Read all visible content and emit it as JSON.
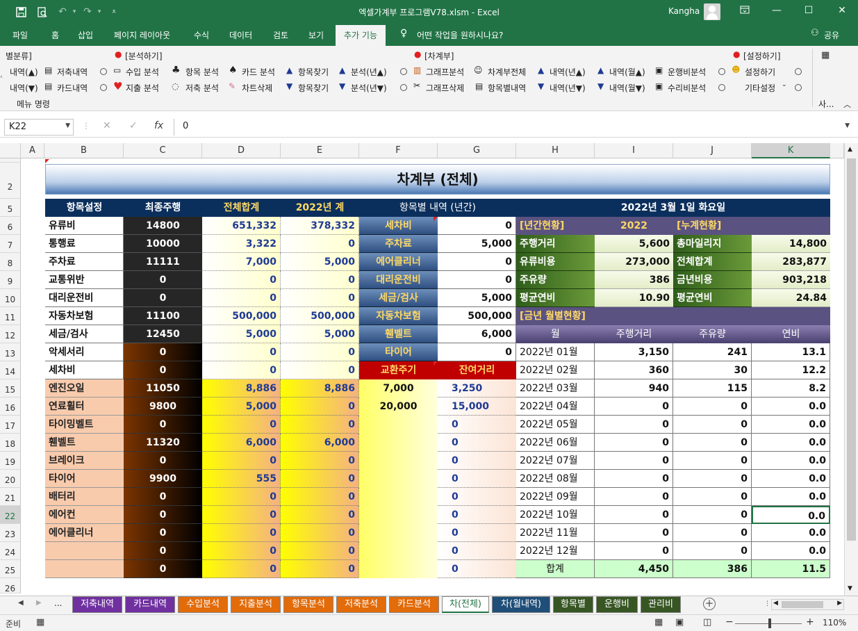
{
  "window": {
    "title": "엑셀가계부 프로그램V78.xlsm  -  Excel",
    "user": "Kangha"
  },
  "menu": {
    "tabs": [
      "파일",
      "홈",
      "삽입",
      "페이지 레이아웃",
      "수식",
      "데이터",
      "검토",
      "보기",
      "추가 기능"
    ],
    "tell_me": "어떤 작업을 원하시나요?",
    "share": "공유"
  },
  "ribbon": {
    "hdr_analysis": "[분석하기]",
    "hdr_ledger": "[차계부]",
    "hdr_settings": "[설정하기]",
    "hdr_cat": "별분류]",
    "r1": [
      "내역(▲)",
      "저축내역",
      "수입 분석",
      "항목 분석",
      "카드 분석",
      "항목찾기",
      "분석(년▲)",
      "그래프분석",
      "차계부전체",
      "내역(년▲)",
      "내역(월▲)",
      "운행비분석",
      "설정하기"
    ],
    "r2": [
      "내역(▼)",
      "카드내역",
      "지출 분석",
      "저축 분석",
      "차트삭제",
      "항목찾기",
      "분석(년▼)",
      "그래프삭제",
      "항목별내역",
      "내역(년▼)",
      "내역(월▼)",
      "수리비분석",
      "기타설정"
    ],
    "group_label": "메뉴 명령",
    "more": "사..."
  },
  "formula": {
    "name_box": "K22",
    "value": "0"
  },
  "columns": [
    "A",
    "B",
    "C",
    "D",
    "E",
    "F",
    "G",
    "H",
    "I",
    "J",
    "K"
  ],
  "rows": [
    "2",
    "5",
    "6",
    "7",
    "8",
    "9",
    "10",
    "11",
    "12",
    "13",
    "14",
    "15",
    "16",
    "17",
    "18",
    "19",
    "20",
    "21",
    "22",
    "23",
    "24",
    "25",
    "26"
  ],
  "sheet_title": "차계부 (전체)",
  "left_headers": [
    "항목설정",
    "최종주행",
    "전체합계",
    "2022년 계"
  ],
  "left_rows": [
    {
      "name": "유류비",
      "odo": "14800",
      "total": "651,332",
      "year": "378,332"
    },
    {
      "name": "통행료",
      "odo": "10000",
      "total": "3,322",
      "year": "0"
    },
    {
      "name": "주차료",
      "odo": "11111",
      "total": "7,000",
      "year": "5,000"
    },
    {
      "name": "교통위반",
      "odo": "0",
      "total": "0",
      "year": "0"
    },
    {
      "name": "대리운전비",
      "odo": "0",
      "total": "0",
      "year": "0"
    },
    {
      "name": "자동차보험",
      "odo": "11100",
      "total": "500,000",
      "year": "500,000"
    },
    {
      "name": "세금/검사",
      "odo": "12450",
      "total": "5,000",
      "year": "5,000"
    },
    {
      "name": "악세서리",
      "odo": "0",
      "total": "0",
      "year": "0"
    },
    {
      "name": "세차비",
      "odo": "0",
      "total": "0",
      "year": "0"
    },
    {
      "name": "엔진오일",
      "odo": "11050",
      "total": "8,886",
      "year": "8,886"
    },
    {
      "name": "연료휠터",
      "odo": "9800",
      "total": "5,000",
      "year": "0"
    },
    {
      "name": "타이밍벨트",
      "odo": "0",
      "total": "0",
      "year": "0"
    },
    {
      "name": "휀벨트",
      "odo": "11320",
      "total": "6,000",
      "year": "6,000"
    },
    {
      "name": "브레이크",
      "odo": "0",
      "total": "0",
      "year": "0"
    },
    {
      "name": "타이어",
      "odo": "9900",
      "total": "555",
      "year": "0"
    },
    {
      "name": "배터리",
      "odo": "0",
      "total": "0",
      "year": "0"
    },
    {
      "name": "에어컨",
      "odo": "0",
      "total": "0",
      "year": "0"
    },
    {
      "name": "에어클리너",
      "odo": "0",
      "total": "0",
      "year": "0"
    },
    {
      "name": "",
      "odo": "0",
      "total": "0",
      "year": "0"
    },
    {
      "name": "",
      "odo": "0",
      "total": "0",
      "year": "0"
    }
  ],
  "item_header": "항목별 내역 (년간)",
  "item_rows": [
    {
      "name": "세차비",
      "value": "0"
    },
    {
      "name": "주차료",
      "value": "5,000"
    },
    {
      "name": "에어클리너",
      "value": "0"
    },
    {
      "name": "대리운전비",
      "value": "0"
    },
    {
      "name": "세금/검사",
      "value": "5,000"
    },
    {
      "name": "자동차보험",
      "value": "500,000"
    },
    {
      "name": "휀벨트",
      "value": "6,000"
    },
    {
      "name": "타이어",
      "value": "0"
    }
  ],
  "exchange": {
    "h1": "교환주기",
    "h2": "잔여거리",
    "rows": [
      [
        "7,000",
        "3,250"
      ],
      [
        "20,000",
        "15,000"
      ],
      [
        "",
        "0"
      ],
      [
        "",
        "0"
      ],
      [
        "",
        "0"
      ],
      [
        "",
        "0"
      ],
      [
        "",
        "0"
      ],
      [
        "",
        "0"
      ],
      [
        "",
        "0"
      ],
      [
        "",
        "0"
      ],
      [
        "",
        "0"
      ]
    ]
  },
  "date": "2022년 3월 1일 화요일",
  "annual": {
    "label": "[년간현황]",
    "year": "2022",
    "rows": [
      [
        "주행거리",
        "5,600"
      ],
      [
        "유류비용",
        "273,000"
      ],
      [
        "주유량",
        "386"
      ],
      [
        "평균연비",
        "10.90"
      ]
    ]
  },
  "cumul": {
    "label": "[누계현황]",
    "rows": [
      [
        "총마일리지",
        "14,800"
      ],
      [
        "전체합계",
        "283,877"
      ],
      [
        "금년비용",
        "903,218"
      ],
      [
        "평균연비",
        "24.84"
      ]
    ]
  },
  "monthly": {
    "label": "[금년 월별현황]",
    "headers": [
      "월",
      "주행거리",
      "주유량",
      "연비"
    ],
    "rows": [
      [
        "2022년 01월",
        "3,150",
        "241",
        "13.1"
      ],
      [
        "2022년 02월",
        "360",
        "30",
        "12.2"
      ],
      [
        "2022년 03월",
        "940",
        "115",
        "8.2"
      ],
      [
        "2022년 04월",
        "0",
        "0",
        "0.0"
      ],
      [
        "2022년 05월",
        "0",
        "0",
        "0.0"
      ],
      [
        "2022년 06월",
        "0",
        "0",
        "0.0"
      ],
      [
        "2022년 07월",
        "0",
        "0",
        "0.0"
      ],
      [
        "2022년 08월",
        "0",
        "0",
        "0.0"
      ],
      [
        "2022년 09월",
        "0",
        "0",
        "0.0"
      ],
      [
        "2022년 10월",
        "0",
        "0",
        "0.0"
      ],
      [
        "2022년 11월",
        "0",
        "0",
        "0.0"
      ],
      [
        "2022년 12월",
        "0",
        "0",
        "0.0"
      ]
    ],
    "total": [
      "합계",
      "4,450",
      "386",
      "11.5"
    ]
  },
  "sheets": [
    {
      "name": "저축내역",
      "color": "#7030a0"
    },
    {
      "name": "카드내역",
      "color": "#7030a0"
    },
    {
      "name": "수입분석",
      "color": "#e26b0a"
    },
    {
      "name": "지출분석",
      "color": "#e26b0a"
    },
    {
      "name": "항목분석",
      "color": "#e26b0a"
    },
    {
      "name": "저축분석",
      "color": "#e26b0a"
    },
    {
      "name": "카드분석",
      "color": "#e26b0a"
    },
    {
      "name": "차(전체)",
      "color": "#ffffff"
    },
    {
      "name": "차(월내역)",
      "color": "#1f4e78"
    },
    {
      "name": "항목별",
      "color": "#375623"
    },
    {
      "name": "운행비",
      "color": "#375623"
    },
    {
      "name": "관리비",
      "color": "#375623"
    }
  ],
  "sheet_ellipsis": "...",
  "status": {
    "ready": "준비",
    "zoom": "110%"
  }
}
